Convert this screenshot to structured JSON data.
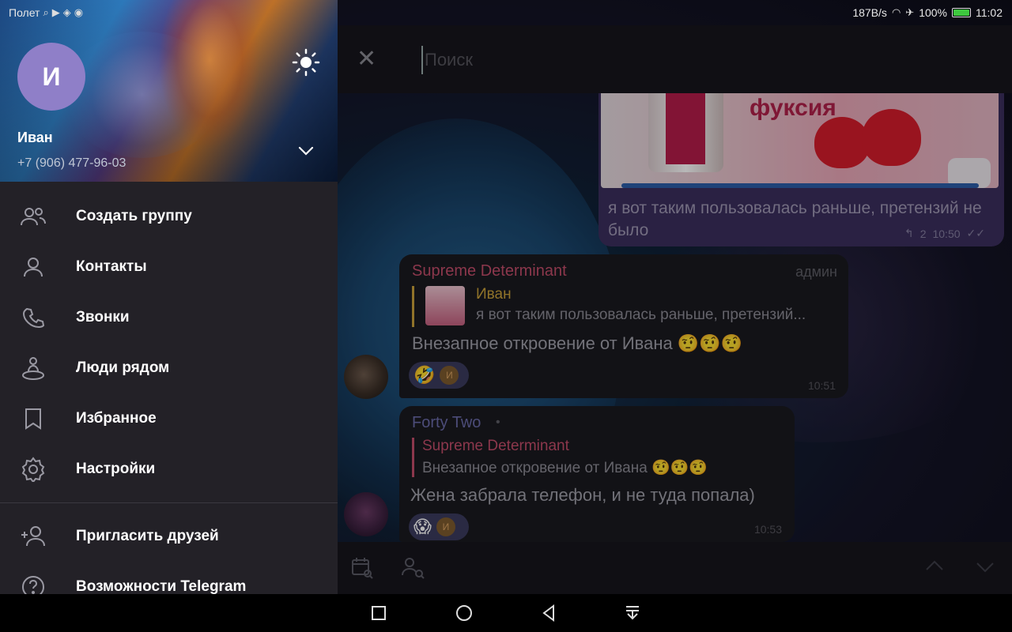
{
  "status_bar": {
    "carrier": "Полет",
    "speed": "187B/s",
    "battery": "100%",
    "battery_level": 1.0,
    "time": "11:02"
  },
  "drawer": {
    "avatar_letter": "И",
    "name": "Иван",
    "phone": "+7 (906) 477-96-03",
    "menu": [
      {
        "label": "Создать группу",
        "icon": "group-icon"
      },
      {
        "label": "Контакты",
        "icon": "contact-icon"
      },
      {
        "label": "Звонки",
        "icon": "phone-icon"
      },
      {
        "label": "Люди рядом",
        "icon": "people-nearby-icon"
      },
      {
        "label": "Избранное",
        "icon": "bookmark-icon"
      },
      {
        "label": "Настройки",
        "icon": "settings-icon"
      }
    ],
    "menu2": [
      {
        "label": "Пригласить друзей",
        "icon": "add-user-icon"
      },
      {
        "label": "Возможности Telegram",
        "icon": "help-icon"
      }
    ]
  },
  "search": {
    "placeholder": "Поиск"
  },
  "messages": {
    "outgoing": {
      "image_text": "фуксия",
      "text": "я вот таким пользовалась раньше, претензий не было",
      "replies": "2",
      "time": "10:50"
    },
    "m1": {
      "sender": "Supreme Determinant",
      "badge": "админ",
      "reply_name": "Иван",
      "reply_text": "я вот таким пользовалась раньше, претензий...",
      "text": "Внезапное откровение от Ивана 🤨🤨🤨",
      "reaction": "🤣",
      "reaction_avatar": "И",
      "time": "10:51"
    },
    "m2": {
      "sender": "Forty Two",
      "reply_name": "Supreme Determinant",
      "reply_text": "Внезапное откровение от Ивана 🤨🤨🤨",
      "text": "Жена забрала телефон, и не туда попала)",
      "reaction": "😱",
      "reaction_avatar": "И",
      "time": "10:53"
    }
  },
  "colors": {
    "accent": "#8f7fc8",
    "drawer_bg": "#232127",
    "sender1": "#c24d6a",
    "sender2": "#6a6aa8",
    "reply1": "#c8a03a"
  }
}
